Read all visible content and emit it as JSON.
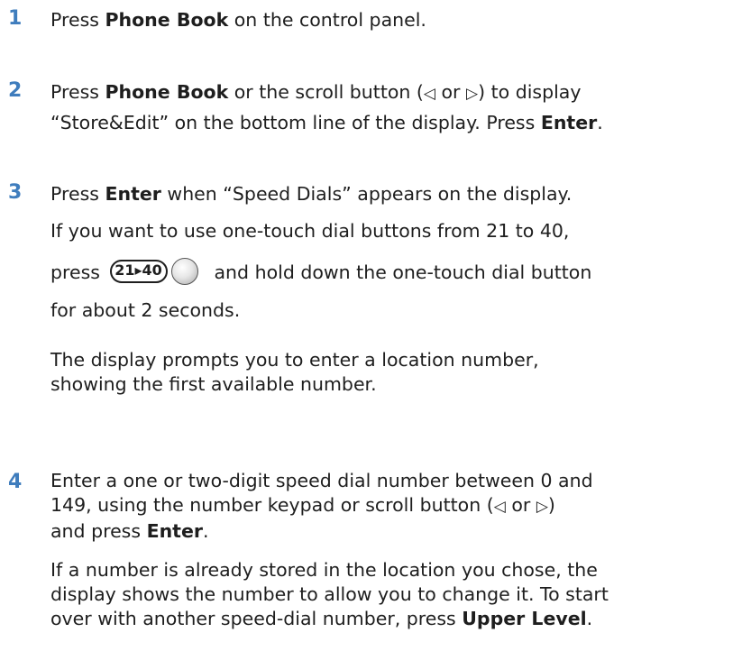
{
  "steps": [
    {
      "number": "1",
      "lines": {
        "a_pre": "Press ",
        "a_bold": "Phone Book",
        "a_post": " on the control panel."
      }
    },
    {
      "number": "2",
      "lines": {
        "a_pre": "Press ",
        "a_bold": "Phone Book",
        "a_mid": " or the scroll button (",
        "left_sym": "◁",
        "or_text": " or ",
        "right_sym": "▷",
        "a_post": ") to display",
        "b_pre": "“Store&Edit” on the bottom line of the display. Press ",
        "b_bold": "Enter",
        "b_post": "."
      }
    },
    {
      "number": "3",
      "lines": {
        "a_pre": "Press ",
        "a_bold": "Enter",
        "a_post": " when “Speed Dials” appears on the display.",
        "b": "If you want to use one-touch dial buttons from 21 to 40,",
        "c_pre": "press",
        "c_key": "21▸40",
        "c_post": "and hold down the one-touch dial button",
        "d": "for about 2 seconds.",
        "e1": "The display prompts you to enter a location number,",
        "e2": "showing the first available number."
      }
    },
    {
      "number": "4",
      "lines": {
        "a": "Enter a one or two-digit speed dial number between 0 and",
        "b_pre": "149, using the number keypad or scroll button (",
        "left_sym": "◁",
        "or_text": " or ",
        "right_sym": "▷",
        "b_post": ")",
        "c_pre": "and press ",
        "c_bold": "Enter",
        "c_post": ".",
        "d1": "If a number is already stored in the location you chose, the",
        "d2": "display shows the number to allow you to change it. To start",
        "d3_pre": "over with another speed-dial number, press ",
        "d3_bold": "Upper Level",
        "d3_post": "."
      }
    }
  ],
  "colors": {
    "step_number": "#3f7dbd",
    "text": "#1e1e1e"
  },
  "icons": {
    "scroll_left": "scroll-left-arrow-icon",
    "scroll_right": "scroll-right-arrow-icon",
    "range_key": "21-40-shift-key-icon",
    "one_touch": "one-touch-dial-button-icon"
  }
}
